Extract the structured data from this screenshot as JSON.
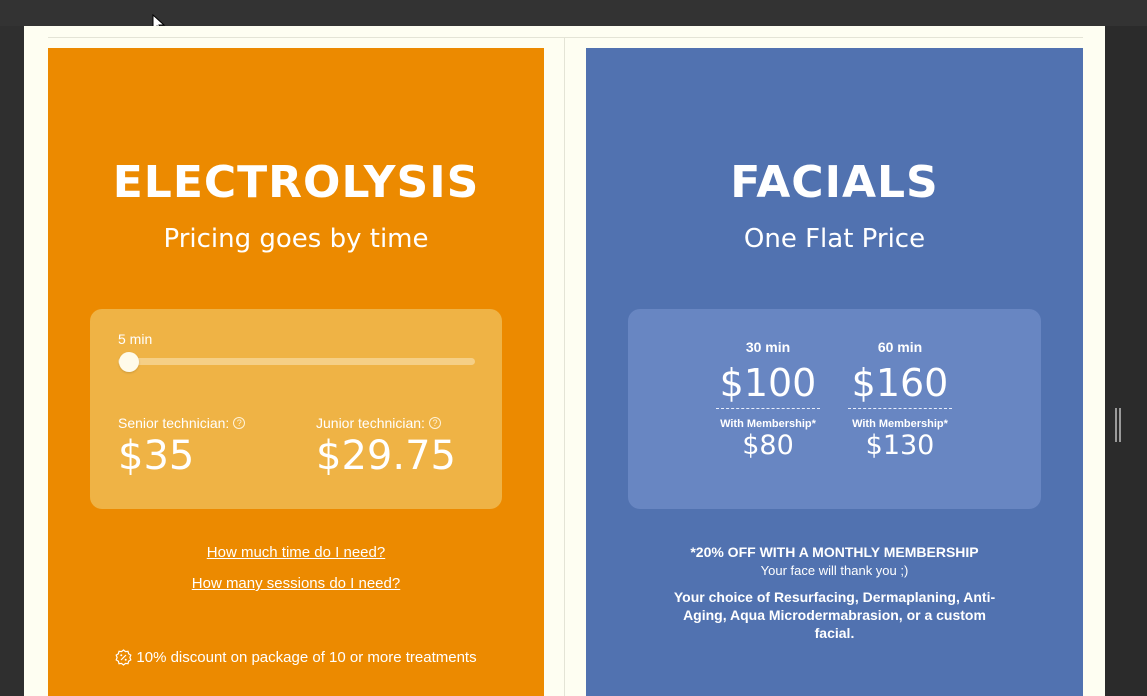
{
  "electrolysis": {
    "title": "ELECTROLYSIS",
    "subtitle": "Pricing goes by time",
    "slider_label": "5 min",
    "slider_value_fraction": 0.0,
    "senior_label": "Senior technician:",
    "senior_price": "$35",
    "junior_label": "Junior technician:",
    "junior_price": "$29.75",
    "link_time": "How much time do I need?",
    "link_sessions": "How many sessions do I need?",
    "discount_text": "10% discount on package of 10 or more treatments",
    "icons": {
      "help": "question-circle-icon",
      "discount": "percent-badge-icon"
    },
    "colors": {
      "card": "#ec8a00",
      "panel": "#efb345"
    }
  },
  "facials": {
    "title": "FACIALS",
    "subtitle": "One Flat Price",
    "options": [
      {
        "duration": "30 min",
        "price": "$100",
        "member_label": "With Membership*",
        "member_price": "$80"
      },
      {
        "duration": "60 min",
        "price": "$160",
        "member_label": "With Membership*",
        "member_price": "$130"
      }
    ],
    "promo_heading": "*20% OFF WITH A MONTHLY MEMBERSHIP",
    "promo_sub": "Your face will thank you ;)",
    "promo_desc": "Your choice of Resurfacing, Dermaplaning, Anti-Aging, Aqua Microdermabrasion, or a custom facial.",
    "colors": {
      "card": "#5172b0",
      "panel": "#6886c2"
    }
  }
}
